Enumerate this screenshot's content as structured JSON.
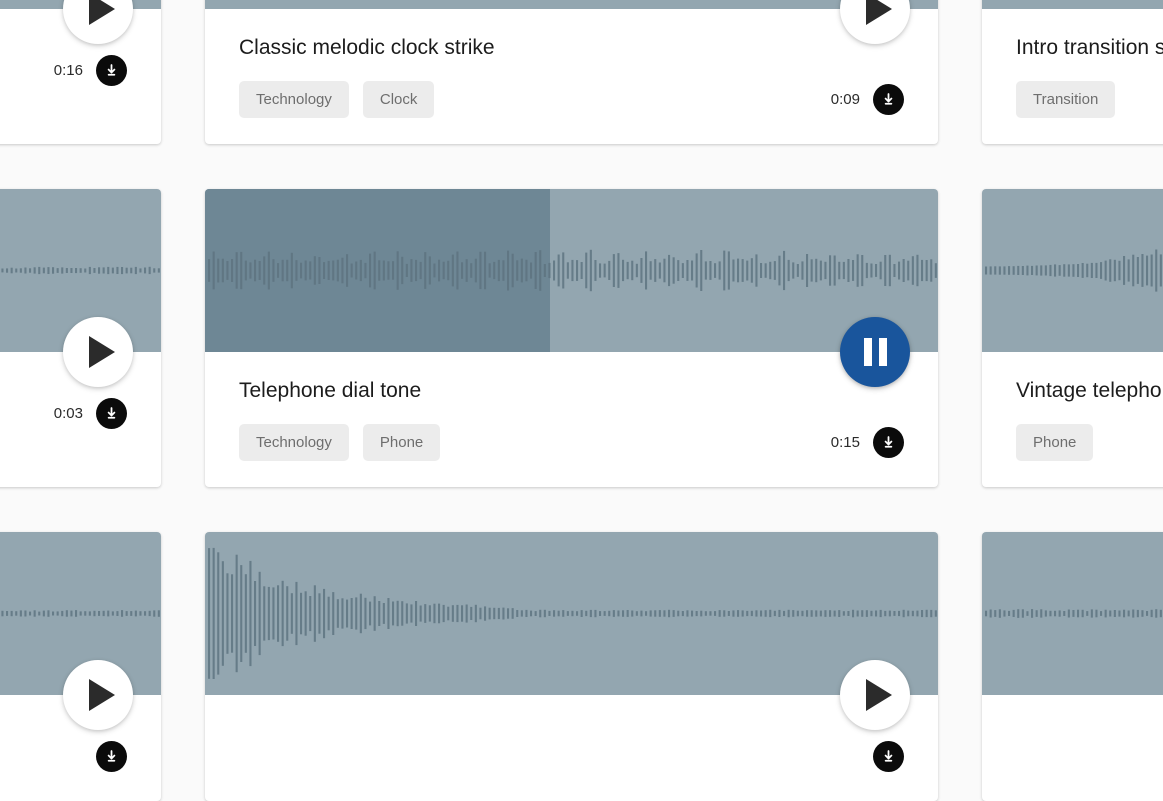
{
  "theme": {
    "page_background": "#fafafa",
    "card_background": "#ffffff",
    "waveform_background": "#93a6b0",
    "waveform_progress": "#6e8795",
    "waveform_bar": "#5d737f",
    "play_button_background": "#ffffff",
    "play_icon_color": "#2b2b2b",
    "pause_button_background": "#19559c",
    "pause_icon_color": "#ffffff",
    "tag_background": "#ececec",
    "tag_text": "#6e6e6e",
    "download_button_background": "#0b0b0b",
    "title_text": "#1c1c1c",
    "duration_text": "#2b2b2b"
  },
  "icons": {
    "play": "play-icon",
    "pause": "pause-icon",
    "download": "download-arrow-icon"
  },
  "cards": [
    {
      "id": "card-r1c1",
      "title": "",
      "tags": [],
      "duration": "0:16",
      "state": "paused",
      "transport_label": "Play",
      "download_label": "Download",
      "progress_percent": 0,
      "waveform_shape": "sparse-ticks"
    },
    {
      "id": "card-r1c2",
      "title": "Classic melodic clock strike",
      "tags": [
        "Technology",
        "Clock"
      ],
      "duration": "0:09",
      "state": "paused",
      "transport_label": "Play",
      "download_label": "Download",
      "progress_percent": 0,
      "waveform_shape": "clock-strikes"
    },
    {
      "id": "card-r1c3",
      "title": "Intro transition swell",
      "tags": [
        "Transition"
      ],
      "duration": "",
      "state": "paused",
      "transport_label": "Play",
      "download_label": "Download",
      "progress_percent": 0,
      "waveform_shape": "dense-swell"
    },
    {
      "id": "card-r2c1",
      "title": "",
      "tags": [],
      "duration": "0:03",
      "state": "paused",
      "transport_label": "Play",
      "download_label": "Download",
      "progress_percent": 0,
      "waveform_shape": "faint-line"
    },
    {
      "id": "card-r2c2",
      "title": "Telephone dial tone",
      "tags": [
        "Technology",
        "Phone"
      ],
      "duration": "0:15",
      "state": "playing",
      "transport_label": "Pause",
      "download_label": "Download",
      "progress_percent": 47,
      "waveform_shape": "dial-tone"
    },
    {
      "id": "card-r2c3",
      "title": "Vintage telephone ring",
      "tags": [
        "Phone"
      ],
      "duration": "",
      "state": "paused",
      "transport_label": "Play",
      "download_label": "Download",
      "progress_percent": 0,
      "waveform_shape": "ring-burst"
    },
    {
      "id": "card-r3c1",
      "title": "",
      "tags": [],
      "duration": "",
      "state": "paused",
      "transport_label": "Play",
      "download_label": "Download",
      "progress_percent": 0,
      "waveform_shape": "thin-tail"
    },
    {
      "id": "card-r3c2",
      "title": "",
      "tags": [],
      "duration": "",
      "state": "paused",
      "transport_label": "Play",
      "download_label": "Download",
      "progress_percent": 0,
      "waveform_shape": "decay-burst"
    },
    {
      "id": "card-r3c3",
      "title": "",
      "tags": [],
      "duration": "",
      "state": "paused",
      "transport_label": "Play",
      "download_label": "Download",
      "progress_percent": 0,
      "waveform_shape": "sparse-tail"
    }
  ]
}
